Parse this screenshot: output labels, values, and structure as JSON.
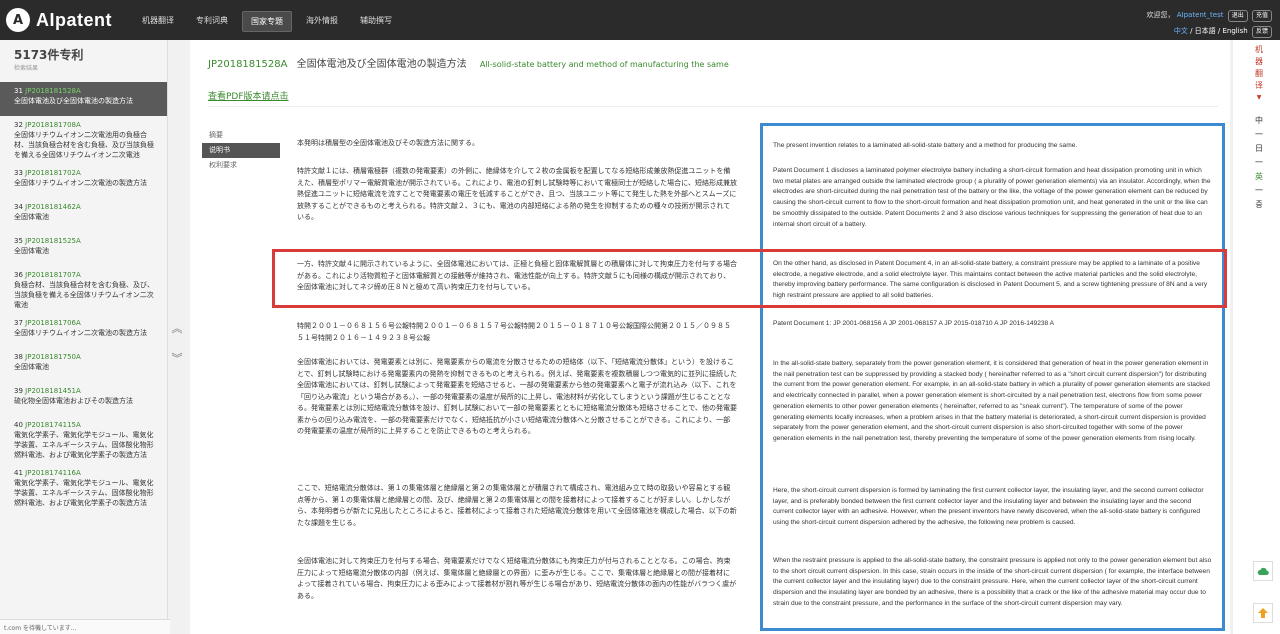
{
  "header": {
    "logo_mark": "A",
    "logo_text": "AIpatent",
    "nav": [
      {
        "label": "机器翻译",
        "active": false
      },
      {
        "label": "专利词典",
        "active": false
      },
      {
        "label": "国家专题",
        "active": true
      },
      {
        "label": "海外情报",
        "active": false
      },
      {
        "label": "辅助撰写",
        "active": false
      }
    ],
    "welcome": "欢迎您，",
    "username": "AIpatent_test",
    "logout": "退出",
    "recharge": "充值",
    "lang_cn": "中文",
    "lang_ja": "日本語",
    "lang_en": "English",
    "lang_sep": " / ",
    "feedback": "反馈"
  },
  "sidebar": {
    "count": "5173件专利",
    "count_sub": "检索结果",
    "items": [
      {
        "num": "31",
        "id": "JP2018181528A",
        "title": "全固体電池及び全固体電池の製造方法",
        "active": true
      },
      {
        "num": "32",
        "id": "JP2018181708A",
        "title": "全固体リチウムイオン二次電池用の負極合材、当該負極合材を含む負極、及び当該負極を備える全固体リチウムイオン二次電池",
        "active": false
      },
      {
        "num": "33",
        "id": "JP2018181702A",
        "title": "全固体リチウムイオン二次電池の製造方法",
        "active": false
      },
      {
        "num": "34",
        "id": "JP2018181462A",
        "title": "全固体電池",
        "active": false
      },
      {
        "num": "35",
        "id": "JP2018181525A",
        "title": "全固体電池",
        "active": false
      },
      {
        "num": "36",
        "id": "JP2018181707A",
        "title": "負極合材、当該負極合材を含む負極、及び、当該負極を備える全固体リチウムイオン二次電池",
        "active": false
      },
      {
        "num": "37",
        "id": "JP2018181706A",
        "title": "全固体リチウムイオン二次電池の製造方法",
        "active": false
      },
      {
        "num": "38",
        "id": "JP2018181750A",
        "title": "全固体電池",
        "active": false
      },
      {
        "num": "39",
        "id": "JP2018181451A",
        "title": "硫化物全固体電池およびその製造方法",
        "active": false
      },
      {
        "num": "40",
        "id": "JP2018174115A",
        "title": "電気化学素子、電気化学モジュール、電気化学装置、エネルギーシステム、固体酸化物形燃料電池、および電気化学素子の製造方法",
        "active": false
      },
      {
        "num": "41",
        "id": "JP2018174116A",
        "title": "電気化学素子、電気化学モジュール、電気化学装置、エネルギーシステム、固体酸化物形燃料電池、および電気化学素子の製造方法",
        "active": false
      }
    ]
  },
  "doc": {
    "id": "JP2018181528A",
    "title_ja": "全固体電池及び全固体電池の製造方法",
    "title_en": "All-solid-state battery and method of manufacturing the same",
    "pdf_link": "查看PDF版本请点击",
    "tabs": [
      {
        "label": "摘要",
        "active": false
      },
      {
        "label": "说明书",
        "active": true
      },
      {
        "label": "权利要求",
        "active": false
      }
    ],
    "ja": [
      "本発明は積層型の全固体電池及びその製造方法に関する。",
      "特許文献１には、積層電極群（複数の発電要素）の外側に、絶縁体を介して２枚の金属板を配置してなる短絡形成兼放熱促進ユニットを備えた、積層型ポリマー電解質電池が開示されている。これにより、電池の釘刺し試験時等において電極同士が短絡した場合に、短絡形成兼放熱促進ユニットに短絡電流を流すことで発電要素の電圧を低減することができ、且つ、当該ユニット等にて発生した熱を外部へとスムーズに放熱することができるものと考えられる。特許文献２、３にも、電池の内部短絡による熱の発生を抑制するための種々の技術が開示されている。",
      "一方、特許文献４に開示されているように、全固体電池においては、正極と負極と固体電解質層との積層体に対して拘束圧力を付与する場合がある。これにより活物質粒子と固体電解質との接触等が維持され、電池性能が向上する。特許文献５にも同様の構成が開示されており、全固体電池に対してネジ締め圧８Ｎと極めて高い拘束圧力を付与している。",
      "特開２００１－０６８１５６号公報特開２００１－０６８１５７号公報特開２０１５－０１８７１０号公報国際公開第２０１５／０９８５５１号特開２０１６－１４９２３８号公報",
      "全固体電池においては、発電要素とは別に、発電要素からの電流を分散させるための短絡体（以下、「短絡電流分散体」という）を設けることで、釘刺し試験時における発電要素内の発熱を抑制できるものと考えられる。例えば、発電要素を複数積層しつつ電気的に並列に接続した全固体電池においては、釘刺し試験によって発電要素を短絡させると、一部の発電要素から他の発電要素へと電子が流れ込み（以下、これを「回り込み電流」という場合がある。）、一部の発電要素の温度が局所的に上昇し、電池材料が劣化してしまうという課題が生じることとなる。発電要素とは別に短絡電流分散体を設け、釘刺し試験において一部の発電要素とともに短絡電流分散体も短絡させることで、他の発電要素からの回り込み電流を、一部の発電要素だけでなく、短絡抵抗が小さい短絡電流分散体へと分散させることができる。これにより、一部の発電要素の温度が局所的に上昇することを防止できるものと考えられる。",
      "ここで、短絡電流分散体は、第１の集電体層と絶縁層と第２の集電体層とが積層されて構成され、電池組み立て時の取扱いや容易とする観点等から、第１の集電体層と絶縁層との間、及び、絶縁層と第２の集電体層との間を接着材によって接着することが好ましい。しかしながら、本発明者らが新たに見出したところによると、接着材によって接着された短絡電流分散体を用いて全固体電池を構成した場合、以下の新たな課題を生じる。",
      "全固体電池に対して拘束圧力を付与する場合、発電要素だけでなく短絡電流分散体にも拘束圧力が付与されることとなる。この場合、拘束圧力によって短絡電流分散体の内部（例えば、集電体層と絶縁層との界面）に歪みが生じる。ここで、集電体層と絶縁層との間が接着材によって接着されている場合、拘束圧力による歪みによって接着材が割れ等が生じる場合があり、短絡電流分散体の面内の性能がバラつく虞がある。"
    ],
    "en": [
      "The present invention relates to a laminated all-solid-state battery and a method for producing the same.",
      "Patent Document 1 discloses a laminated polymer electrolyte battery including a short-circuit formation and heat dissipation promoting unit in which two metal plates are arranged outside the laminated electrode group ( a plurality of power generation elements) via an insulator. Accordingly, when the electrodes are short-circuited during the nail penetration test of the battery or the like, the voltage of the power generation element can be reduced by causing the short-circuit current to flow to the short-circuit formation and heat dissipation promotion unit, and heat generated in the unit or the like can be smoothly dissipated to the outside. Patent Documents 2 and 3 also disclose various techniques for suppressing the generation of heat due to an internal short circuit of a battery.",
      "On the other hand, as disclosed in Patent Document 4, in an all-solid-state battery, a constraint pressure may be applied to a laminate of a positive electrode, a negative electrode, and a solid electrolyte layer. This maintains contact between the active material particles and the solid electrolyte, thereby improving battery performance. The same configuration is disclosed in Patent Document 5, and a screw tightening pressure of 8N and a very high restraint pressure are applied to all solid batteries.",
      "Patent Document 1: JP 2001-068156 A JP 2001-068157 A JP 2015-018710 A JP 2016-149238 A",
      "In the all-solid-state battery, separately from the power generation element, it is considered that generation of heat in the power generation element in the nail penetration test can be suppressed by providing a stacked body ( hereinafter referred to as a \"short circuit current dispersion\") for distributing the current from the power generation element. For example, in an all-solid-state battery in which a plurality of power generation elements are stacked and electrically connected in parallel, when a power generation element is short-circuited by a nail penetration test, electrons flow from some power generation elements to other power generation elements ( hereinafter, referred to as \"sneak current\"). The temperature of some of the power generating elements locally increases, when a problem arises in that the battery material is deteriorated, a short-circuit current dispersion is provided separately from the power generation element, and the short-circuit current dispersion is also short-circuited together with some of the power generation elements in the nail penetration test, thereby preventing the temperature of some of the power generation elements from rising locally.",
      "Here, the short-circuit current dispersion is formed by laminating the first current collector layer, the insulating layer, and the second current collector layer, and is preferably bonded between the first current collector layer and the insulating layer and between the insulating layer and the second current collector layer with an adhesive. However, when the present inventors have newly discovered, when the all-solid-state battery is configured using the short-circuit current dispersion adhered by the adhesive, the following new problem is caused.",
      "When the restraint pressure is applied to the all-solid-state battery, the constraint pressure is applied not only to the power generation element but also to the short circuit current dispersion. In this case, strain occurs in the inside of the short-circuit current dispersion ( for example, the interface between the current collector layer and the insulating layer) due to the constraint pressure. Here, when the current collector layer of the short-circuit current dispersion and the insulating layer are bonded by an adhesive, there is a possibility that a crack or the like of the adhesive material may occur due to strain due to the constraint pressure, and the performance in the surface of the short-circuit current dispersion may vary."
    ]
  },
  "rightrail": {
    "mt_chars": [
      "机",
      "器",
      "翻",
      "译"
    ],
    "mt_caret": "▼",
    "lang_chars": [
      "中",
      "一",
      "日",
      "一",
      "英",
      "一",
      "중"
    ]
  },
  "status": "t.com を待機しています..."
}
